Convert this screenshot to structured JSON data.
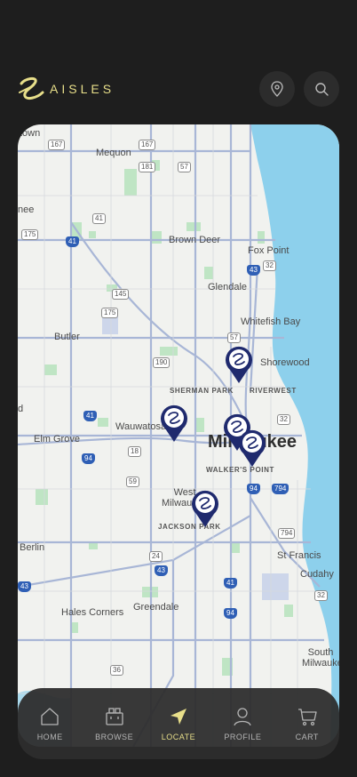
{
  "brand": {
    "name": "AISLES",
    "color": "#e8df8a"
  },
  "header": {
    "location_button": "location-pin-icon",
    "search_button": "search-icon"
  },
  "map": {
    "labels": {
      "mequon": "Mequon",
      "town": "town",
      "nee": "nee",
      "brown_deer": "Brown Deer",
      "fox_point": "Fox Point",
      "glendale": "Glendale",
      "whitefish_bay": "Whitefish Bay",
      "butler": "Butler",
      "shorewood": "Shorewood",
      "sherman_park": "SHERMAN PARK",
      "riverwest": "RIVERWEST",
      "wauwatosa": "Wauwatosa",
      "milwaukee": "Milwaukee",
      "elm_grove": "Elm Grove",
      "walkers_point": "WALKER'S POINT",
      "west_milwaukee": "West Milwaukee",
      "jackson_park": "JACKSON PARK",
      "berlin": "Berlin",
      "st_francis": "St Francis",
      "cudahy": "Cudahy",
      "hales_corners": "Hales Corners",
      "greendale": "Greendale",
      "south_milwaukee": "South Milwaukee",
      "d": "d"
    },
    "highways": {
      "h167a": "167",
      "h167b": "167",
      "h181": "181",
      "h57a": "57",
      "h41a": "41",
      "h175a": "175",
      "h41b": "41",
      "h43a": "43",
      "h32a": "32",
      "h145": "145",
      "h175b": "175",
      "h57b": "57",
      "h190": "190",
      "h41c": "41",
      "h32b": "32",
      "h18": "18",
      "h94a": "94",
      "h59": "59",
      "h94b": "94",
      "h794a": "794",
      "h794b": "794",
      "h24": "24",
      "h43b": "43",
      "h41d": "41",
      "h43c": "43",
      "h94c": "94",
      "h36": "36",
      "h32c": "32"
    },
    "store_pins": [
      "store-pin",
      "store-pin",
      "store-pin",
      "store-pin",
      "store-pin"
    ]
  },
  "nav": {
    "items": [
      {
        "label": "HOME",
        "icon": "home-icon"
      },
      {
        "label": "BROWSE",
        "icon": "browse-icon"
      },
      {
        "label": "LOCATE",
        "icon": "navigation-arrow-icon",
        "active": true
      },
      {
        "label": "PROFILE",
        "icon": "user-icon"
      },
      {
        "label": "CART",
        "icon": "cart-icon"
      }
    ]
  }
}
